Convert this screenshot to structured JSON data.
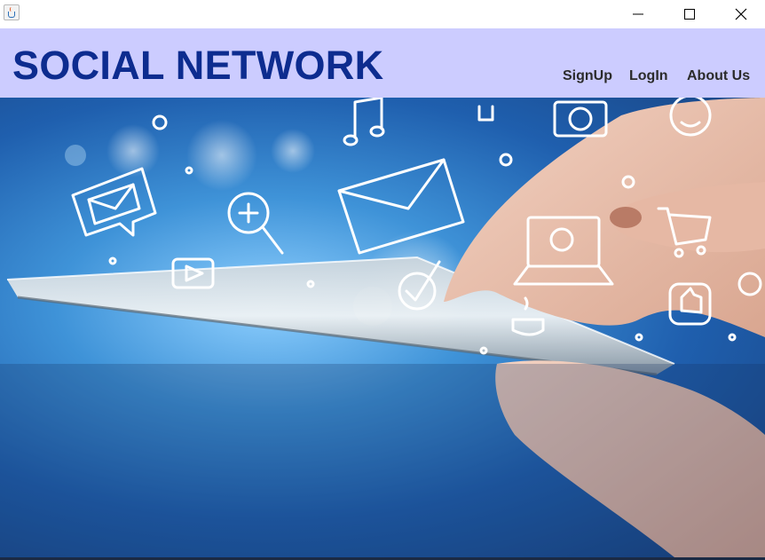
{
  "window": {
    "icons": {
      "app": "java-cup-icon",
      "minimize": "minimize-icon",
      "maximize": "maximize-icon",
      "close": "close-icon"
    }
  },
  "header": {
    "brand": "SOCIAL NETWORK",
    "nav": [
      {
        "label": "SignUp"
      },
      {
        "label": "LogIn"
      },
      {
        "label": "About Us"
      }
    ]
  },
  "hero": {
    "image": "hands-touching-tablet-with-social-media-icons",
    "icons": [
      "envelope-icon",
      "music-note-icon",
      "camera-icon",
      "smiley-icon",
      "chat-mail-icon",
      "search-plus-icon",
      "play-icon",
      "laptop-icon",
      "checkmark-icon",
      "coffee-cup-icon",
      "shopping-cart-icon",
      "like-icon"
    ]
  },
  "colors": {
    "header_bg": "#ccccff",
    "brand": "#0d2c8f",
    "nav_text": "#2b2b2b",
    "hero_blue": "#3f93d8"
  }
}
